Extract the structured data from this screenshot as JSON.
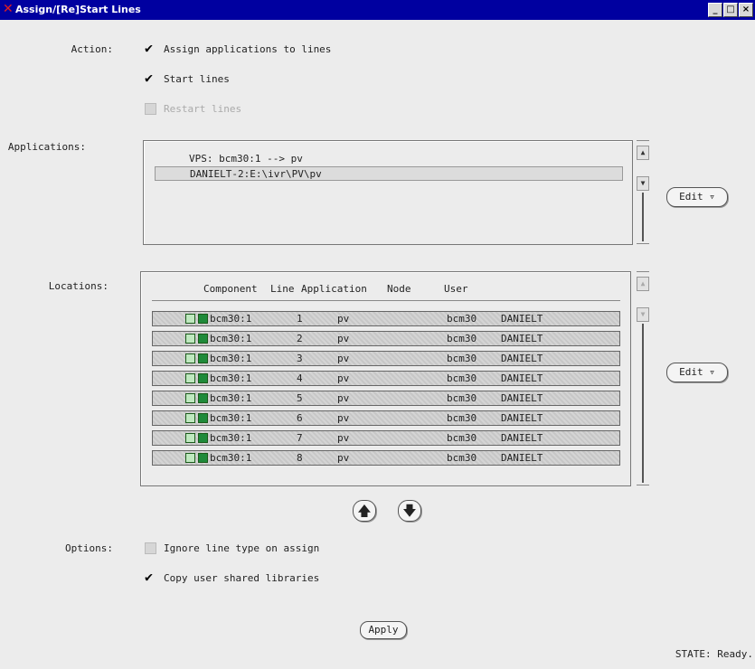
{
  "window": {
    "title": "Assign/[Re]Start Lines",
    "controls": [
      "_",
      "□",
      "×"
    ]
  },
  "action": {
    "label": "Action:",
    "options": [
      {
        "label": "Assign applications to lines",
        "checked": true,
        "enabled": true
      },
      {
        "label": "Start lines",
        "checked": true,
        "enabled": true
      },
      {
        "label": "Restart lines",
        "checked": false,
        "enabled": false
      }
    ]
  },
  "applications": {
    "label": "Applications:",
    "items": [
      "VPS: bcm30:1 --> pv",
      "DANIELT-2:E:\\ivr\\PV\\pv"
    ],
    "edit_label": "Edit ▿"
  },
  "locations": {
    "label": "Locations:",
    "columns": [
      "Component",
      "Line",
      "Application",
      "Node",
      "User"
    ],
    "rows": [
      {
        "component": "bcm30:1",
        "line": "1",
        "application": "pv",
        "node": "bcm30",
        "user": "DANIELT"
      },
      {
        "component": "bcm30:1",
        "line": "2",
        "application": "pv",
        "node": "bcm30",
        "user": "DANIELT"
      },
      {
        "component": "bcm30:1",
        "line": "3",
        "application": "pv",
        "node": "bcm30",
        "user": "DANIELT"
      },
      {
        "component": "bcm30:1",
        "line": "4",
        "application": "pv",
        "node": "bcm30",
        "user": "DANIELT"
      },
      {
        "component": "bcm30:1",
        "line": "5",
        "application": "pv",
        "node": "bcm30",
        "user": "DANIELT"
      },
      {
        "component": "bcm30:1",
        "line": "6",
        "application": "pv",
        "node": "bcm30",
        "user": "DANIELT"
      },
      {
        "component": "bcm30:1",
        "line": "7",
        "application": "pv",
        "node": "bcm30",
        "user": "DANIELT"
      },
      {
        "component": "bcm30:1",
        "line": "8",
        "application": "pv",
        "node": "bcm30",
        "user": "DANIELT"
      }
    ],
    "edit_label": "Edit ▿",
    "move_up_icon": "arrow-up-icon",
    "move_down_icon": "arrow-down-icon"
  },
  "options": {
    "label": "Options:",
    "items": [
      {
        "label": "Ignore line type on assign",
        "checked": false
      },
      {
        "label": "Copy user shared libraries",
        "checked": true
      }
    ]
  },
  "apply_label": "Apply",
  "status": "STATE: Ready.",
  "colors": {
    "titlebar": "#0000a0",
    "row_icon_green": "#1f8a3a",
    "close_x": "#e02020"
  }
}
